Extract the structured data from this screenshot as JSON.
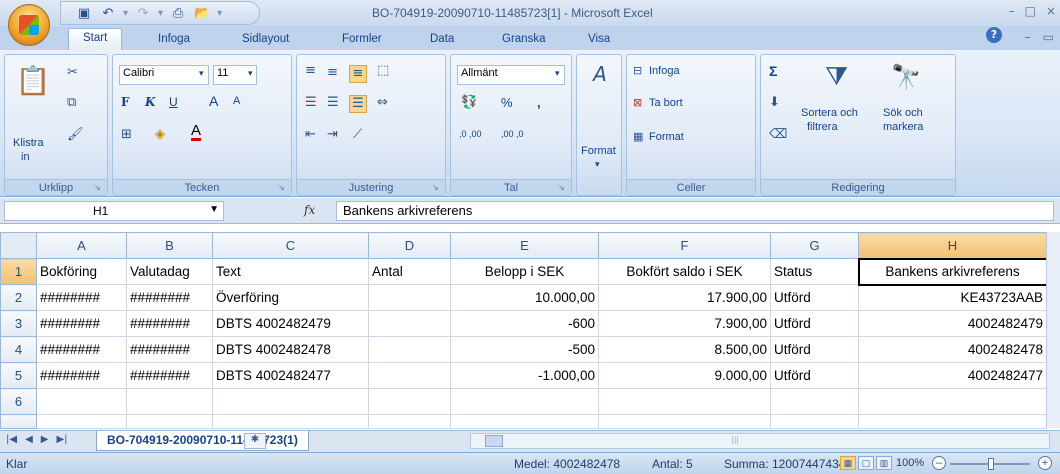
{
  "window": {
    "title": "BO-704919-20090710-11485723[1] - Microsoft Excel",
    "controls": [
      "–",
      "□",
      "×"
    ]
  },
  "qat": {
    "icons": [
      "save-icon",
      "undo-icon",
      "redo-icon",
      "print-preview-icon",
      "open-icon"
    ]
  },
  "tabs": [
    "Start",
    "Infoga",
    "Sidlayout",
    "Formler",
    "Data",
    "Granska",
    "Visa"
  ],
  "ribbon": {
    "urklipp": {
      "label": "Urklipp",
      "paste": "Klistra",
      "paste_sub": "in"
    },
    "tecken": {
      "label": "Tecken",
      "font": "Calibri",
      "size": "11",
      "bold": "F",
      "italic": "K",
      "underline": "U",
      "grow": "A",
      "shrink": "A"
    },
    "justering": {
      "label": "Justering"
    },
    "tal": {
      "label": "Tal",
      "format": "Allmänt",
      "percent": "%",
      "comma": ",",
      "inc": ",0 ,00",
      "dec": ",00 ,0"
    },
    "format": {
      "label": "Format"
    },
    "celler": {
      "label": "Celler",
      "insert": "Infoga",
      "delete": "Ta bort",
      "format": "Format"
    },
    "redigering": {
      "label": "Redigering",
      "sum": "Σ",
      "sort": "Sortera och",
      "sort_sub": "filtrera",
      "find": "Sök och",
      "find_sub": "markera"
    }
  },
  "formula_bar": {
    "name_box": "H1",
    "fx": "fx",
    "formula": "Bankens arkivreferens"
  },
  "columns": [
    "A",
    "B",
    "C",
    "D",
    "E",
    "F",
    "G",
    "H"
  ],
  "rows": [
    {
      "num": "1",
      "cells": [
        "Bokföring",
        "Valutadag",
        "Text",
        "Antal",
        "Belopp i SEK",
        "Bokfört saldo i SEK",
        "Status",
        "Bankens arkivreferens"
      ]
    },
    {
      "num": "2",
      "cells": [
        "########",
        "########",
        "Överföring",
        "",
        "10.000,00",
        "17.900,00",
        "Utförd",
        "KE43723AAB"
      ]
    },
    {
      "num": "3",
      "cells": [
        "########",
        "########",
        "DBTS 4002482479",
        "",
        "-600",
        "7.900,00",
        "Utförd",
        "4002482479"
      ]
    },
    {
      "num": "4",
      "cells": [
        "########",
        "########",
        "DBTS 4002482478",
        "",
        "-500",
        "8.500,00",
        "Utförd",
        "4002482478"
      ]
    },
    {
      "num": "5",
      "cells": [
        "########",
        "########",
        "DBTS 4002482477",
        "",
        "-1.000,00",
        "9.000,00",
        "Utförd",
        "4002482477"
      ]
    },
    {
      "num": "6",
      "cells": [
        "",
        "",
        "",
        "",
        "",
        "",
        "",
        ""
      ]
    },
    {
      "num": "",
      "cells": [
        "",
        "",
        "",
        "",
        "",
        "",
        "",
        ""
      ]
    }
  ],
  "sheet_tab": "BO-704919-20090710-11485723(1)",
  "status": {
    "mode": "Klar",
    "average": "Medel: 4002482478",
    "count": "Antal: 5",
    "sum": "Summa: 12007447434",
    "zoom": "100%"
  }
}
